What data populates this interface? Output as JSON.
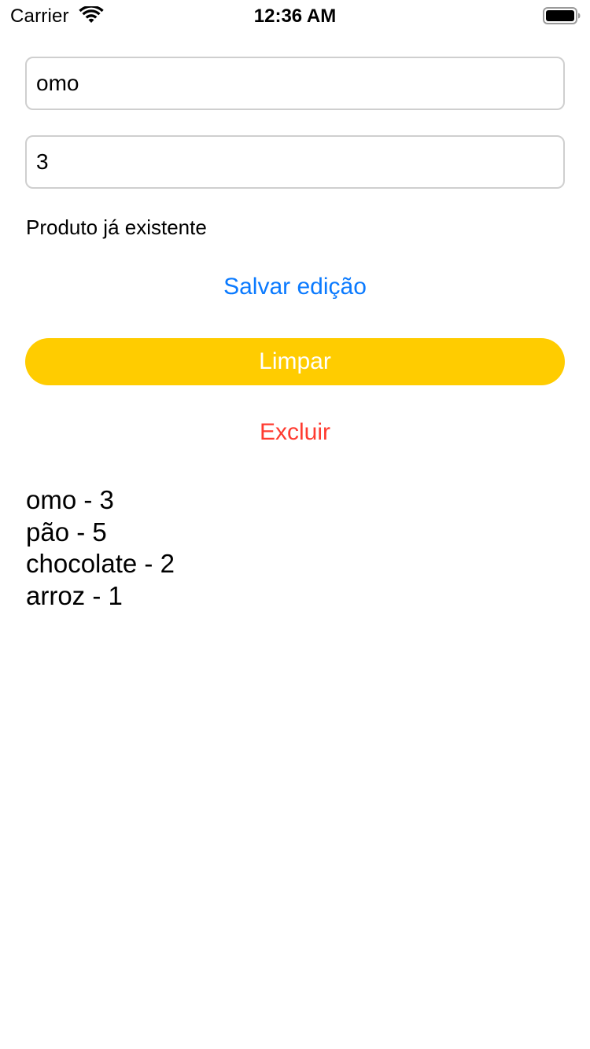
{
  "status_bar": {
    "carrier": "Carrier",
    "time": "12:36 AM",
    "wifi_icon": "wifi-icon",
    "battery_icon": "battery-icon"
  },
  "form": {
    "product_value": "omo",
    "quantity_value": "3",
    "message": "Produto já existente"
  },
  "actions": {
    "save_label": "Salvar edição",
    "clear_label": "Limpar",
    "delete_label": "Excluir"
  },
  "colors": {
    "accent_blue": "#0a7aff",
    "clear_button": "#ffcc00",
    "delete_red": "#ff3b30"
  },
  "products": [
    "omo - 3",
    "pão - 5",
    "chocolate - 2",
    "arroz - 1"
  ]
}
